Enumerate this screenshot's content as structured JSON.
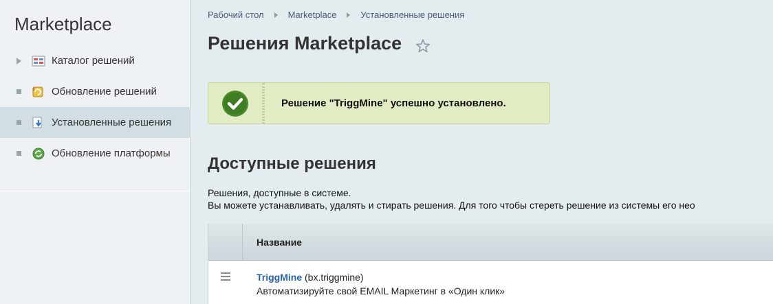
{
  "sidebar": {
    "title": "Marketplace",
    "items": [
      {
        "label": "Каталог решений",
        "icon": "catalog-icon",
        "marker": "arrow",
        "active": false
      },
      {
        "label": "Обновление решений",
        "icon": "update-solutions-icon",
        "marker": "dot",
        "active": false
      },
      {
        "label": "Установленные решения",
        "icon": "installed-solutions-icon",
        "marker": "dot",
        "active": true
      },
      {
        "label": "Обновление платформы",
        "icon": "platform-update-icon",
        "marker": "dot",
        "active": false
      }
    ]
  },
  "breadcrumb": [
    "Рабочий стол",
    "Marketplace",
    "Установленные решения"
  ],
  "page": {
    "title": "Решения Marketplace"
  },
  "notice": {
    "text": "Решение \"TriggMine\" успешно установлено.",
    "status": "success"
  },
  "section": {
    "title": "Доступные решения",
    "desc_line1": "Решения, доступные в системе.",
    "desc_line2": "Вы можете устанавливать, удалять и стирать решения. Для того чтобы стереть решение из системы его нео"
  },
  "table": {
    "header_name": "Название",
    "rows": [
      {
        "name": "TriggMine",
        "code": "(bx.triggmine)",
        "description": "Автоматизируйте свой EMAIL Маркетинг в «Один клик»"
      }
    ]
  },
  "colors": {
    "accent_link": "#2a64a8",
    "success_bg": "#e2ecc4",
    "success_icon": "#4a8a2a"
  }
}
